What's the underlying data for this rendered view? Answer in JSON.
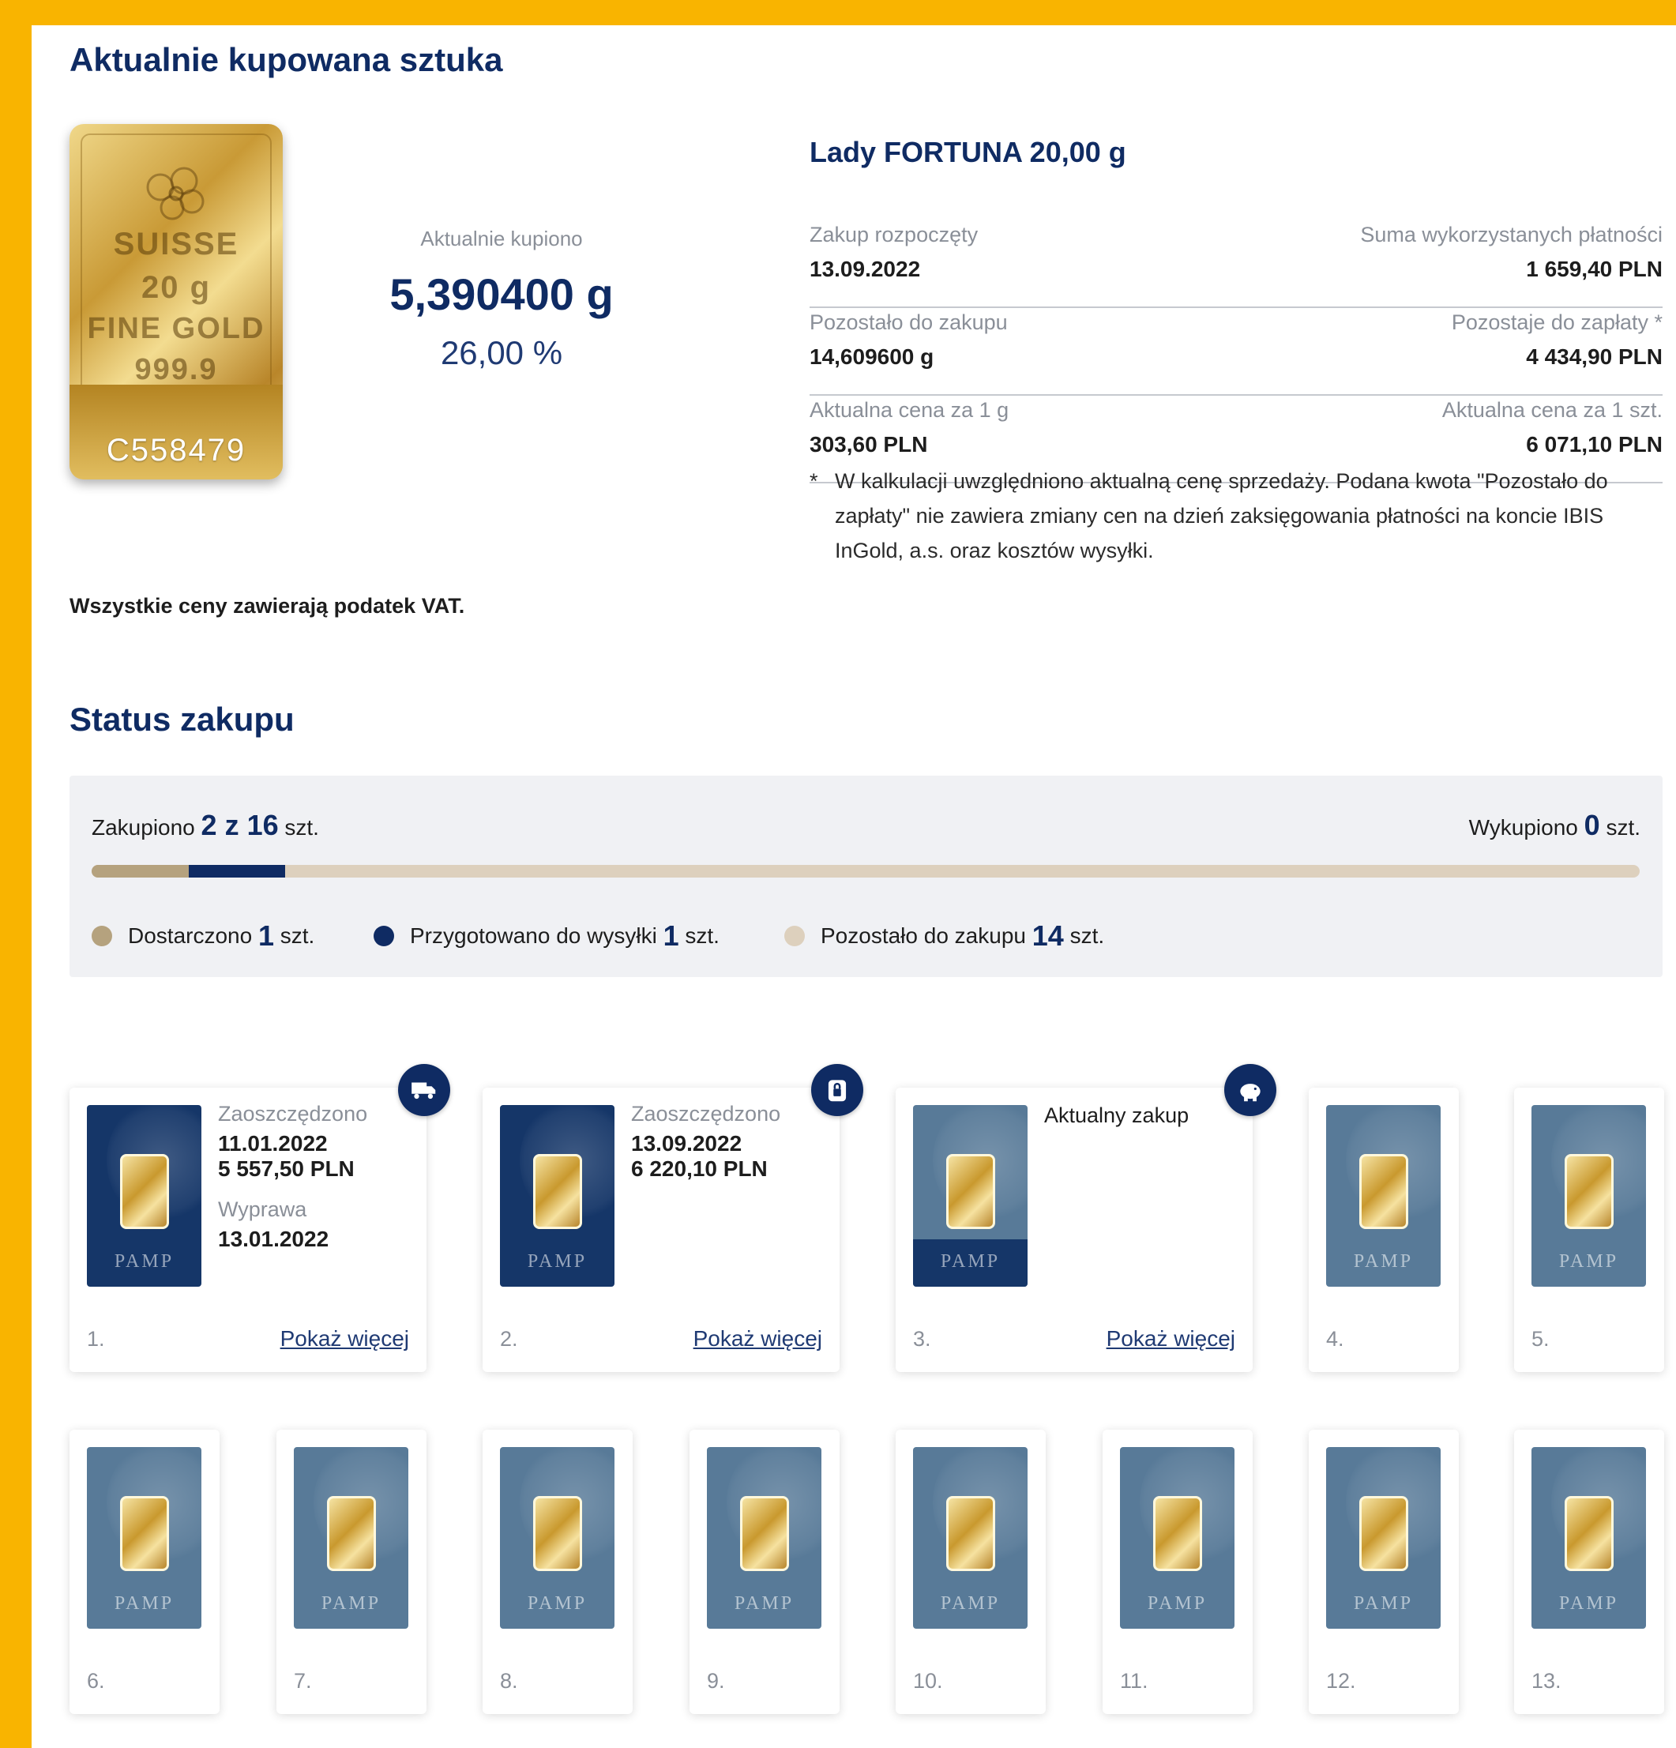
{
  "sections": {
    "current_title": "Aktualnie kupowana sztuka",
    "status_title": "Status zakupu"
  },
  "product_image": {
    "line1": "SUISSE",
    "line2": "20 g",
    "line3": "FINE GOLD",
    "line4": "999.9",
    "serial": "C558479"
  },
  "bought": {
    "label": "Aktualnie kupiono",
    "grams": "5,390400 g",
    "percent": "26,00 %"
  },
  "product": {
    "name": "Lady FORTUNA 20,00 g",
    "rows": [
      {
        "left_label": "Zakup rozpoczęty",
        "left_value": "13.09.2022",
        "right_label": "Suma wykorzystanych płatności",
        "right_value": "1 659,40 PLN"
      },
      {
        "left_label": "Pozostało do zakupu",
        "left_value": "14,609600 g",
        "right_label": "Pozostaje do zapłaty *",
        "right_value": "4 434,90 PLN"
      },
      {
        "left_label": "Aktualna cena za 1 g",
        "left_value": "303,60 PLN",
        "right_label": "Aktualna cena za 1 szt.",
        "right_value": "6 071,10 PLN"
      }
    ],
    "footnote_star": "*",
    "footnote": "W kalkulacji uwzględniono aktualną cenę sprzedaży. Podana kwota \"Pozostało do zapłaty\" nie zawiera zmiany cen na dzień zaksięgowania płatności na koncie IBIS InGold, a.s. oraz kosztów wysyłki."
  },
  "vat_note": "Wszystkie ceny zawierają podatek VAT.",
  "status": {
    "bought_prefix": "Zakupiono",
    "bought_count": "2 z 16",
    "bought_suffix": "szt.",
    "redeemed_prefix": "Wykupiono",
    "redeemed_count": "0",
    "redeemed_suffix": "szt.",
    "progress": {
      "delivered_fraction": 0.0625,
      "prepared_fraction": 0.0625
    },
    "legend": [
      {
        "label": "Dostarczono",
        "count": "1",
        "unit": "szt.",
        "color": "#b5a27e"
      },
      {
        "label": "Przygotowano do wysyłki",
        "count": "1",
        "unit": "szt.",
        "color": "#0f2b63"
      },
      {
        "label": "Pozostało do zakupu",
        "count": "14",
        "unit": "szt.",
        "color": "#ddd0bd"
      }
    ]
  },
  "cards": {
    "c1": {
      "number": "1.",
      "label1": "Zaoszczędzono",
      "date1": "11.01.2022",
      "amount1": "5 557,50 PLN",
      "label2": "Wyprawa",
      "date2": "13.01.2022",
      "more": "Pokaż więcej",
      "pamp": "PAMP"
    },
    "c2": {
      "number": "2.",
      "label1": "Zaoszczędzono",
      "date1": "13.09.2022",
      "amount1": "6 220,10 PLN",
      "more": "Pokaż więcej",
      "pamp": "PAMP"
    },
    "c3": {
      "number": "3.",
      "label1": "Aktualny zakup",
      "more": "Pokaż więcej",
      "pamp": "PAMP"
    },
    "small": [
      {
        "number": "4.",
        "pamp": "PAMP"
      },
      {
        "number": "5.",
        "pamp": "PAMP"
      },
      {
        "number": "6.",
        "pamp": "PAMP"
      },
      {
        "number": "7.",
        "pamp": "PAMP"
      },
      {
        "number": "8.",
        "pamp": "PAMP"
      },
      {
        "number": "9.",
        "pamp": "PAMP"
      },
      {
        "number": "10.",
        "pamp": "PAMP"
      },
      {
        "number": "11.",
        "pamp": "PAMP"
      },
      {
        "number": "12.",
        "pamp": "PAMP"
      },
      {
        "number": "13.",
        "pamp": "PAMP"
      }
    ]
  }
}
